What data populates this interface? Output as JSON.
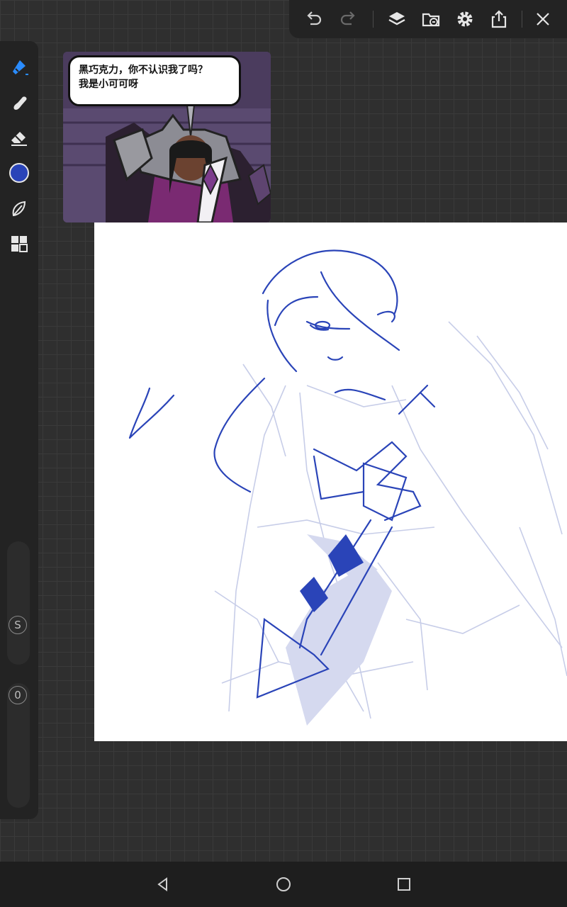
{
  "toolbar": {
    "undo": "undo-icon",
    "redo": "redo-icon",
    "layers": "layers-icon",
    "import": "import-image-icon",
    "settings": "gear-icon",
    "share": "share-icon",
    "close": "close-icon"
  },
  "tools": [
    {
      "name": "pen-tool",
      "icon": "pen-icon",
      "active": true
    },
    {
      "name": "smudge-tool",
      "icon": "smudge-icon"
    },
    {
      "name": "eraser-tool",
      "icon": "eraser-icon"
    },
    {
      "name": "color-picker",
      "icon": "color-swatch",
      "color": "#2a44b8"
    },
    {
      "name": "selection-tool",
      "icon": "lasso-icon"
    },
    {
      "name": "gallery-tool",
      "icon": "grid-icon"
    }
  ],
  "sliders": {
    "size_label": "S",
    "opacity_label": "0"
  },
  "reference": {
    "speech_line1": "黑巧克力，你不认识我了吗？",
    "speech_line2": "我是小可可呀"
  },
  "colors": {
    "accent": "#2a8cff",
    "brush": "#2a44b8",
    "sketch": "#c7cde8"
  }
}
